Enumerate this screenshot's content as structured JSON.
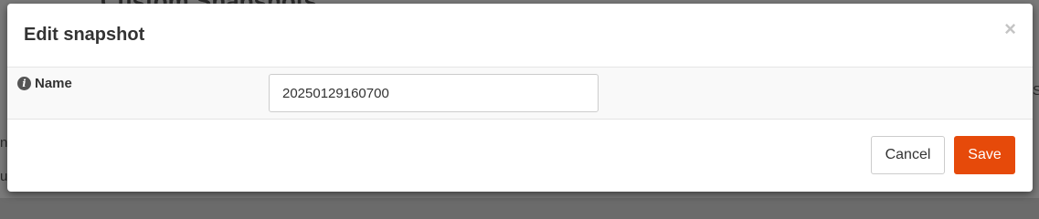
{
  "background": {
    "heading": "Custom Snapshots",
    "fragments": [
      "ne",
      "u",
      "S"
    ]
  },
  "modal": {
    "title": "Edit snapshot",
    "close_label": "×",
    "fields": {
      "name_label": "Name",
      "name_value": "20250129160700"
    },
    "footer": {
      "cancel_label": "Cancel",
      "save_label": "Save"
    }
  },
  "colors": {
    "primary": "#e64a0a"
  },
  "icons": {
    "info": "info-circle-icon",
    "close": "close-icon"
  }
}
